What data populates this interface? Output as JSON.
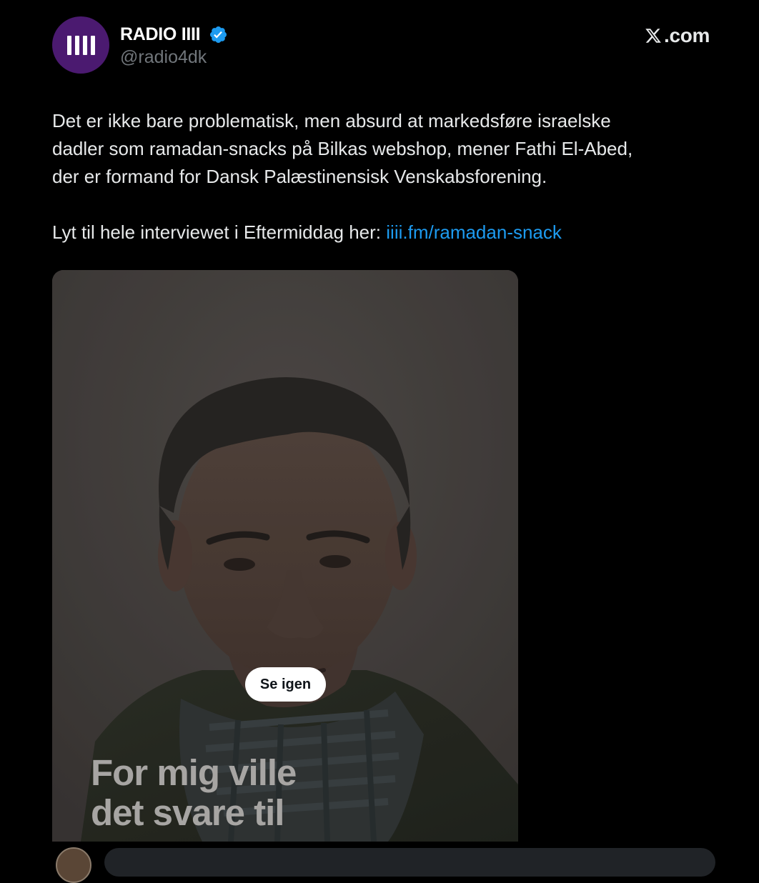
{
  "header": {
    "display_name": "RADIO IIII",
    "handle": "@radio4dk",
    "site": ".com"
  },
  "tweet": {
    "lines": [
      "Det er ikke bare problematisk, men absurd at markedsføre israelske",
      "dadler som ramadan-snacks på Bilkas webshop, mener Fathi El-Abed,",
      "der er formand for Dansk Palæstinensisk Venskabsforening."
    ],
    "cta_prefix": "Lyt til hele interviewet i Eftermiddag her: ",
    "link_text": "iiii.fm/ramadan-snack"
  },
  "media": {
    "caption_lines": [
      "For mig ville",
      "det svare til"
    ],
    "replay_label": "Se igen"
  },
  "icons": {
    "avatar": "radio-iiii-logo",
    "verified": "verified-badge-icon",
    "brand": "x-logo-icon"
  },
  "colors": {
    "background": "#000000",
    "avatar_bg": "#4b1a70",
    "verified": "#1d9bf0",
    "link": "#1d9bf0",
    "text": "#e7e9ea",
    "muted": "#71767b"
  }
}
